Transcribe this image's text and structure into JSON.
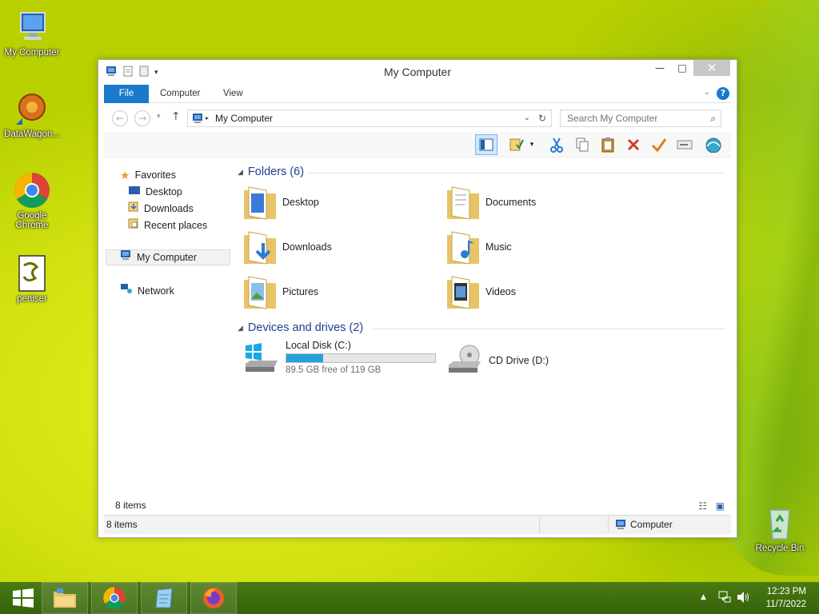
{
  "desktop": {
    "icons": [
      {
        "label": "My Computer"
      },
      {
        "label": "DataWagon..."
      },
      {
        "label": "Google Chrome"
      },
      {
        "label": "peniser"
      },
      {
        "label": "Recycle Bin"
      }
    ]
  },
  "window": {
    "title": "My Computer",
    "ribbon_tabs": [
      "File",
      "Computer",
      "View"
    ],
    "address": "My Computer",
    "search_placeholder": "Search My Computer",
    "nav": {
      "favorites": "Favorites",
      "desktop": "Desktop",
      "downloads": "Downloads",
      "recent": "Recent places",
      "my_computer": "My Computer",
      "network": "Network"
    },
    "folders_header": "Folders (6)",
    "folders": [
      "Desktop",
      "Documents",
      "Downloads",
      "Music",
      "Pictures",
      "Videos"
    ],
    "devices_header": "Devices and drives (2)",
    "drives": [
      {
        "name": "Local Disk (C:)",
        "free": "89.5 GB free of 119 GB",
        "used_fraction": 0.248
      },
      {
        "name": "CD Drive (D:)"
      }
    ],
    "items_count": "8 items",
    "status_left": "8 items",
    "status_right": "Computer"
  },
  "taskbar": {
    "time": "12:23 PM",
    "date": "11/7/2022"
  },
  "colors": {
    "accent": "#1979ca",
    "drive_fill": "#26a0da",
    "group_header": "#1e3f8f"
  }
}
